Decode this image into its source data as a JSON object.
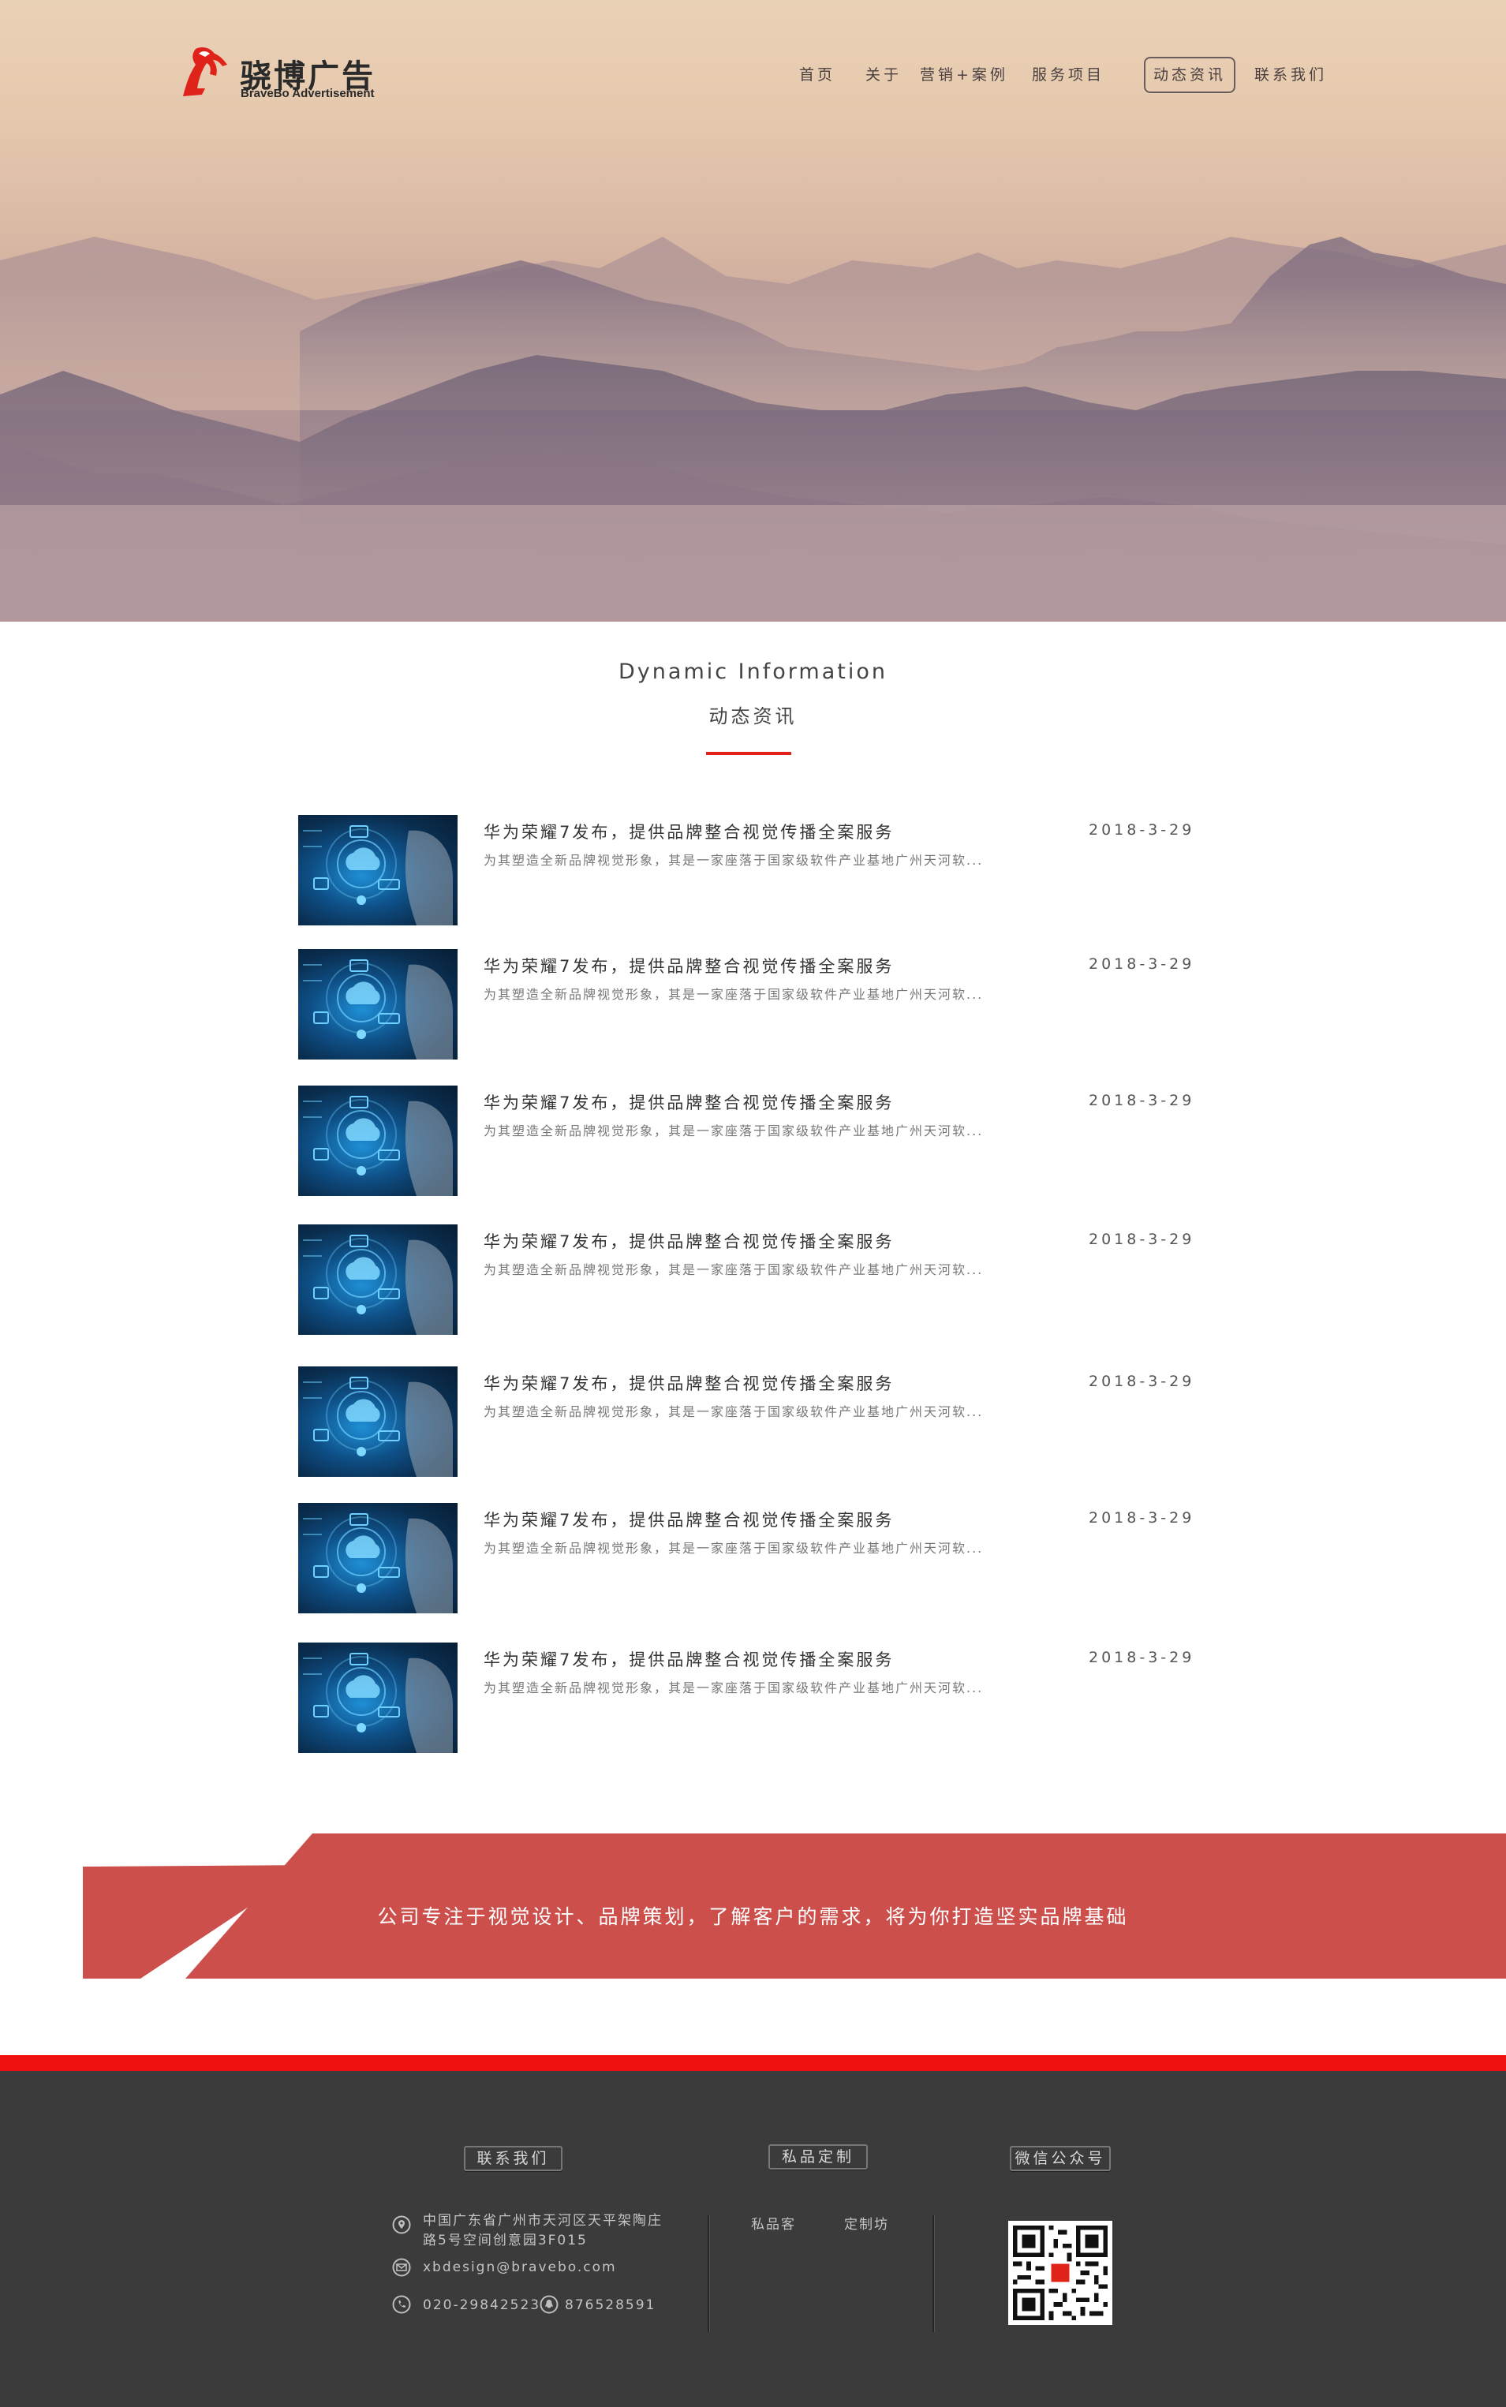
{
  "brand": {
    "name_cn": "骁博广告",
    "name_en": "BraveBo Advertisement",
    "accent_color": "#e0231a"
  },
  "nav": {
    "items": [
      {
        "label": "首页",
        "active": false
      },
      {
        "label": "关于",
        "active": false
      },
      {
        "label": "营销+案例",
        "active": false
      },
      {
        "label": "服务项目",
        "active": false
      },
      {
        "label": "动态资讯",
        "active": true
      },
      {
        "label": "联系我们",
        "active": false
      }
    ]
  },
  "section": {
    "title_en": "Dynamic Information",
    "title_cn": "动态资讯"
  },
  "news": [
    {
      "title": "华为荣耀7发布，提供品牌整合视觉传播全案服务",
      "desc": "为其塑造全新品牌视觉形象，其是一家座落于国家级软件产业基地广州天河软...",
      "date": "2018-3-29"
    },
    {
      "title": "华为荣耀7发布，提供品牌整合视觉传播全案服务",
      "desc": "为其塑造全新品牌视觉形象，其是一家座落于国家级软件产业基地广州天河软...",
      "date": "2018-3-29"
    },
    {
      "title": "华为荣耀7发布，提供品牌整合视觉传播全案服务",
      "desc": "为其塑造全新品牌视觉形象，其是一家座落于国家级软件产业基地广州天河软...",
      "date": "2018-3-29"
    },
    {
      "title": "华为荣耀7发布，提供品牌整合视觉传播全案服务",
      "desc": "为其塑造全新品牌视觉形象，其是一家座落于国家级软件产业基地广州天河软...",
      "date": "2018-3-29"
    },
    {
      "title": "华为荣耀7发布，提供品牌整合视觉传播全案服务",
      "desc": "为其塑造全新品牌视觉形象，其是一家座落于国家级软件产业基地广州天河软...",
      "date": "2018-3-29"
    },
    {
      "title": "华为荣耀7发布，提供品牌整合视觉传播全案服务",
      "desc": "为其塑造全新品牌视觉形象，其是一家座落于国家级软件产业基地广州天河软...",
      "date": "2018-3-29"
    },
    {
      "title": "华为荣耀7发布，提供品牌整合视觉传播全案服务",
      "desc": "为其塑造全新品牌视觉形象，其是一家座落于国家级软件产业基地广州天河软...",
      "date": "2018-3-29"
    }
  ],
  "banner": {
    "text": "公司专注于视觉设计、品牌策划，了解客户的需求，将为你打造坚实品牌基础",
    "color": "#cc4f4c"
  },
  "footer": {
    "contact_title": "联系我们",
    "custom_title": "私品定制",
    "wechat_title": "微信公众号",
    "address_line1": "中国广东省广州市天河区天平架陶庄",
    "address_line2": "路5号空间创意园3F015",
    "email": "xbdesign@bravebo.com",
    "phone": "020-29842523",
    "qq": "876528591",
    "custom_links": [
      "私品客",
      "定制坊"
    ],
    "background": "#3b3b3b",
    "top_line_color": "#f00f0f"
  }
}
